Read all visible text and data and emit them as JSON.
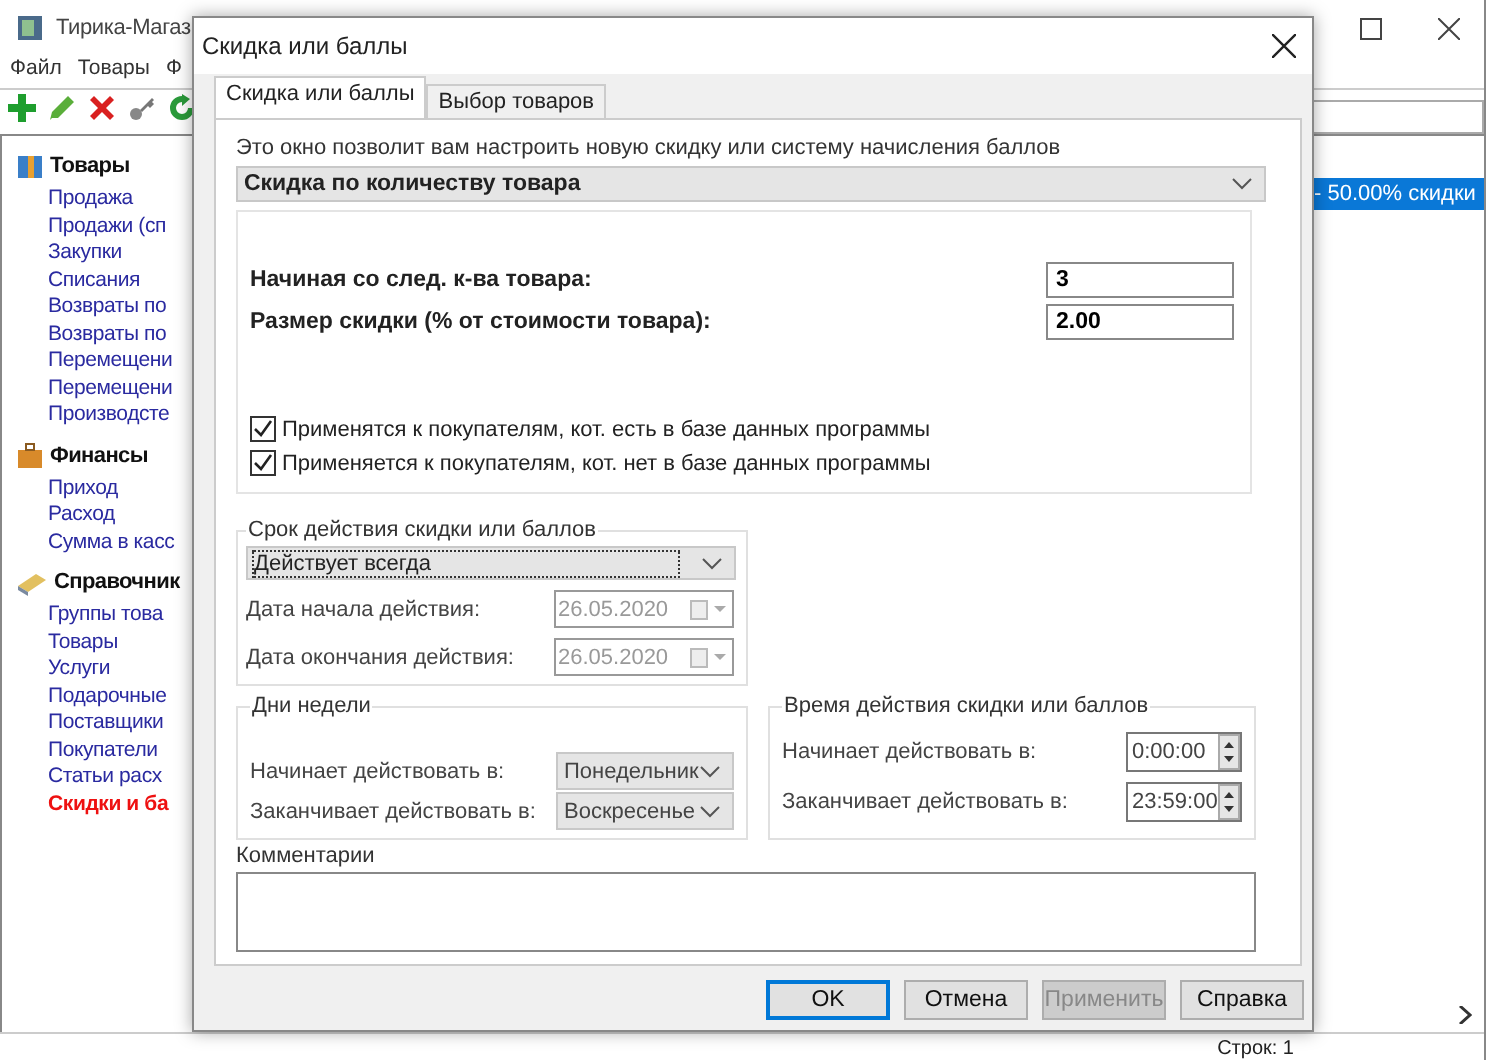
{
  "app": {
    "title": "Тирика-Магаз",
    "menu": [
      "Файл",
      "Товары",
      "Ф"
    ],
    "sidebar": [
      {
        "kind": "box",
        "title": "Товары",
        "items": [
          {
            "label": "Продажа",
            "selected": false
          },
          {
            "label": "Продажи (сп",
            "selected": false
          },
          {
            "label": "Закупки",
            "selected": false
          },
          {
            "label": "Списания",
            "selected": false
          },
          {
            "label": "Возвраты по",
            "selected": false
          },
          {
            "label": "Возвраты по",
            "selected": false
          },
          {
            "label": "Перемещени",
            "selected": false
          },
          {
            "label": "Перемещени",
            "selected": false
          },
          {
            "label": "Производсте",
            "selected": false
          }
        ]
      },
      {
        "kind": "case",
        "title": "Финансы",
        "items": [
          {
            "label": "Приход",
            "selected": false
          },
          {
            "label": "Расход",
            "selected": false
          },
          {
            "label": "Сумма в касс",
            "selected": false
          }
        ]
      },
      {
        "kind": "book",
        "title": "Справочник",
        "items": [
          {
            "label": "Группы това",
            "selected": false
          },
          {
            "label": "Товары",
            "selected": false
          },
          {
            "label": "Услуги",
            "selected": false
          },
          {
            "label": "Подарочные",
            "selected": false
          },
          {
            "label": "Поставщики",
            "selected": false
          },
          {
            "label": "Покупатели",
            "selected": false
          },
          {
            "label": "Статьи расх",
            "selected": false
          },
          {
            "label": "Скидки и ба",
            "selected": true
          }
        ]
      }
    ],
    "list": [
      {
        "text": "- 50.00% скидки",
        "selected": true
      }
    ],
    "status_bar": "Строк: 1"
  },
  "dialog": {
    "title": "Скидка или баллы",
    "tabs": [
      {
        "label": "Скидка или баллы",
        "selected": true
      },
      {
        "label": "Выбор товаров",
        "selected": false
      }
    ],
    "intro": "Это окно позволит вам настроить новую скидку или систему начисления баллов",
    "discount_type": "Скидка по количеству товара",
    "fields": [
      {
        "label": "Начиная со след. к-ва товара:",
        "value": "3"
      },
      {
        "label": "Размер скидки (% от стоимости товара):",
        "value": "2.00"
      }
    ],
    "checkboxes": [
      {
        "label": "Применятся к покупателям, кот. есть в базе данных программы",
        "checked": true
      },
      {
        "label": "Применяется к покупателям, кот. нет в базе данных программы",
        "checked": true
      }
    ],
    "validity": {
      "title": "Срок действия скидки или баллов",
      "mode": "Действует всегда",
      "dates": [
        {
          "label": "Дата начала действия:",
          "value": "26.05.2020",
          "disabled": true
        },
        {
          "label": "Дата окончания действия:",
          "value": "26.05.2020",
          "disabled": true
        }
      ]
    },
    "weekdays": {
      "title": "Дни недели",
      "rows": [
        {
          "label": "Начинает действовать в:",
          "value": "Понедельник"
        },
        {
          "label": "Заканчивает действовать в:",
          "value": "Воскресенье"
        }
      ]
    },
    "time": {
      "title": "Время действия скидки или баллов",
      "rows": [
        {
          "label": "Начинает действовать в:",
          "value": "0:00:00"
        },
        {
          "label": "Заканчивает действовать в:",
          "value": "23:59:00"
        }
      ]
    },
    "comments": {
      "label": "Комментарии"
    },
    "buttons": [
      {
        "label": "OK",
        "default": true,
        "disabled": false
      },
      {
        "label": "Отмена",
        "default": false,
        "disabled": false
      },
      {
        "label": "Применить",
        "default": false,
        "disabled": true
      },
      {
        "label": "Справка",
        "default": false,
        "disabled": false
      }
    ]
  }
}
